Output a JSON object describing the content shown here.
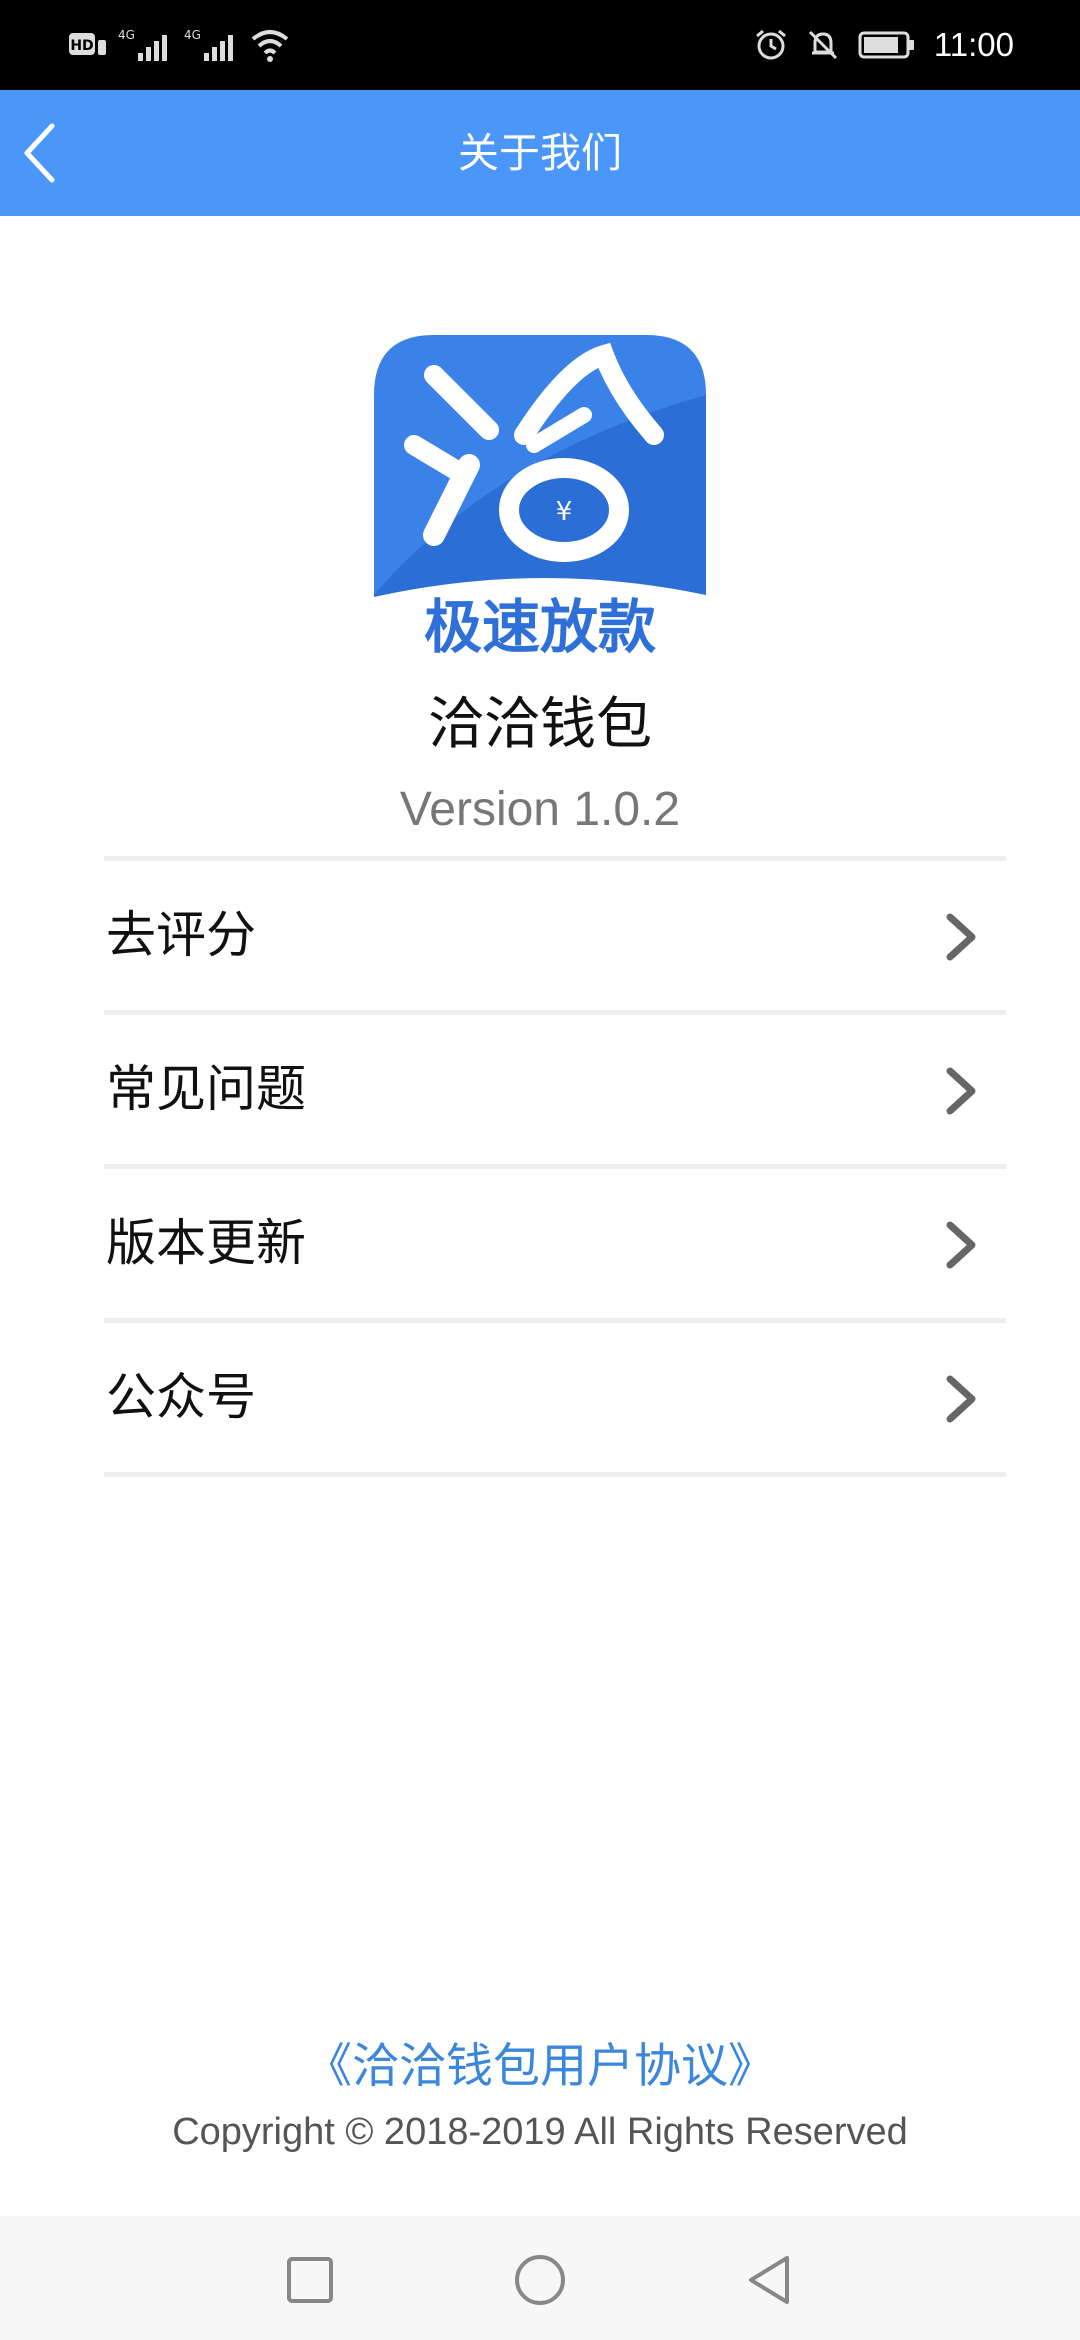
{
  "status_bar": {
    "time": "11:00",
    "icons": [
      "hd-icon",
      "signal-4g-icon",
      "signal-4g-icon",
      "wifi-icon",
      "alarm-icon",
      "bell-off-icon",
      "battery-icon"
    ]
  },
  "header": {
    "title": "关于我们",
    "back_icon": "chevron-left-icon",
    "background": "#4A96F9"
  },
  "app": {
    "logo_char": "洽",
    "logo_tagline": "极速放款",
    "logo_currency": "¥",
    "name": "洽洽钱包",
    "version": "Version 1.0.2"
  },
  "menu": {
    "items": [
      {
        "label": "去评分"
      },
      {
        "label": "常见问题"
      },
      {
        "label": "版本更新"
      },
      {
        "label": "公众号"
      }
    ]
  },
  "footer": {
    "agreement_link": "《洽洽钱包用户协议》",
    "copyright": "Copyright © 2018-2019 All Rights Reserved",
    "link_color": "#3C87DB"
  },
  "system_nav": {
    "buttons": [
      "recents-square-icon",
      "home-circle-icon",
      "back-triangle-icon"
    ]
  }
}
